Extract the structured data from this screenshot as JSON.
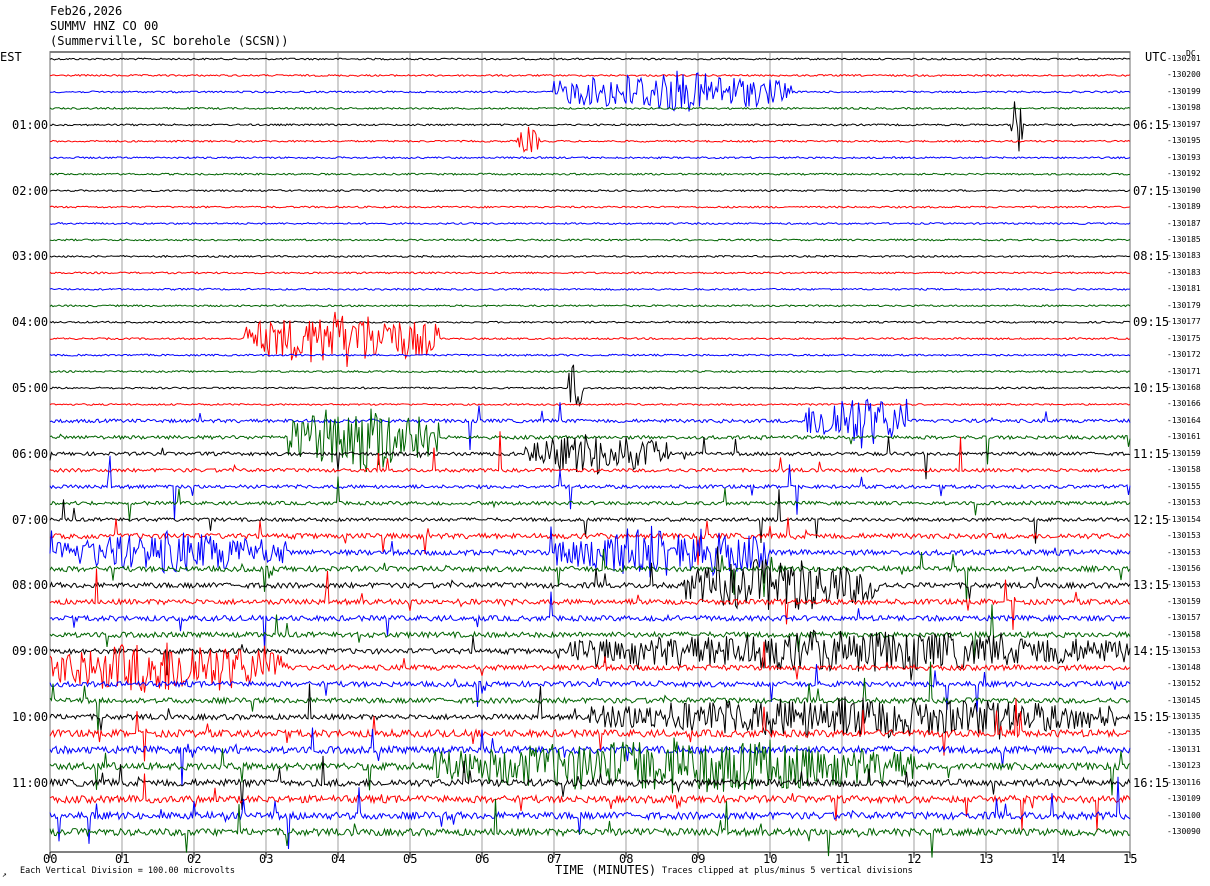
{
  "header": {
    "date": "Feb26,2026",
    "channel": "SUMMV HNZ CO 00",
    "station": "(Summerville, SC borehole (SCSN))"
  },
  "tz_left": "EST",
  "tz_right": "UTC",
  "dc_label": "DC",
  "footer": {
    "division_note": "Each Vertical Division =  100.00 microvolts",
    "x_axis_title": "TIME (MINUTES)",
    "clip_note": "Traces clipped at plus/minus 5 vertical divisions",
    "corner_mark": "↗"
  },
  "colors": {
    "trace_cycle": [
      "#000000",
      "#ff0000",
      "#0000ff",
      "#006400"
    ],
    "grid": "#888888"
  },
  "chart_data": {
    "type": "line",
    "title": "",
    "xlabel": "TIME (MINUTES)",
    "xlim": [
      0,
      15
    ],
    "x_ticks": [
      "00",
      "01",
      "02",
      "03",
      "04",
      "05",
      "06",
      "07",
      "08",
      "09",
      "10",
      "11",
      "12",
      "13",
      "14",
      "15"
    ],
    "left_time_labels": [
      "01:00",
      "02:00",
      "03:00",
      "04:00",
      "05:00",
      "06:00",
      "07:00",
      "08:00",
      "09:00",
      "10:00",
      "11:00"
    ],
    "right_time_labels": [
      "06:15",
      "07:15",
      "08:15",
      "09:15",
      "10:15",
      "11:15",
      "12:15",
      "13:15",
      "14:15",
      "15:15",
      "16:15"
    ],
    "dc_offsets": [
      "-130201",
      "-130200",
      "-130199",
      "-130198",
      "-130197",
      "-130195",
      "-130193",
      "-130192",
      "-130190",
      "-130189",
      "-130187",
      "-130185",
      "-130183",
      "-130183",
      "-130181",
      "-130179",
      "-130177",
      "-130175",
      "-130172",
      "-130171",
      "-130168",
      "-130166",
      "-130164",
      "-130161",
      "-130159",
      "-130158",
      "-130155",
      "-130153",
      "-130154",
      "-130153",
      "-130153",
      "-130156",
      "-130153",
      "-130159",
      "-130157",
      "-130158",
      "-130153",
      "-130148",
      "-130152",
      "-130145",
      "-130135",
      "-130135",
      "-130131",
      "-130123",
      "-130116",
      "-130109",
      "-130100",
      "-130090"
    ],
    "trace_activity": [
      1,
      1,
      1,
      1,
      1,
      1,
      1,
      1,
      1,
      1,
      1,
      1,
      1,
      1,
      1,
      1,
      1,
      1,
      1,
      1,
      1,
      1,
      2,
      2,
      2,
      2,
      2,
      2,
      2,
      3,
      3,
      3,
      3,
      3,
      3,
      3,
      3,
      3,
      3,
      3,
      3,
      4,
      4,
      4,
      4,
      4,
      4,
      4
    ],
    "events": [
      {
        "trace": 2,
        "start_min": 7.0,
        "end_min": 10.3,
        "amp": 3.0
      },
      {
        "trace": 4,
        "start_min": 13.35,
        "end_min": 13.5,
        "amp": 5.0
      },
      {
        "trace": 5,
        "start_min": 6.5,
        "end_min": 6.8,
        "amp": 2.0
      },
      {
        "trace": 17,
        "start_min": 2.7,
        "end_min": 5.4,
        "amp": 4.0
      },
      {
        "trace": 20,
        "start_min": 7.2,
        "end_min": 7.4,
        "amp": 4.0
      },
      {
        "trace": 22,
        "start_min": 10.5,
        "end_min": 11.9,
        "amp": 4.0
      },
      {
        "trace": 23,
        "start_min": 3.3,
        "end_min": 5.4,
        "amp": 5.0
      },
      {
        "trace": 24,
        "start_min": 6.6,
        "end_min": 8.6,
        "amp": 3.0
      },
      {
        "trace": 30,
        "start_min": 0.1,
        "end_min": 3.3,
        "amp": 3.0
      },
      {
        "trace": 30,
        "start_min": 7.0,
        "end_min": 10.0,
        "amp": 4.0
      },
      {
        "trace": 32,
        "start_min": 8.8,
        "end_min": 11.5,
        "amp": 4.0
      },
      {
        "trace": 36,
        "start_min": 7.2,
        "end_min": 15.0,
        "amp": 3.0
      },
      {
        "trace": 37,
        "start_min": 0.0,
        "end_min": 3.3,
        "amp": 4.0
      },
      {
        "trace": 40,
        "start_min": 7.5,
        "end_min": 14.8,
        "amp": 3.0
      },
      {
        "trace": 43,
        "start_min": 5.3,
        "end_min": 12.0,
        "amp": 4.0
      }
    ]
  }
}
